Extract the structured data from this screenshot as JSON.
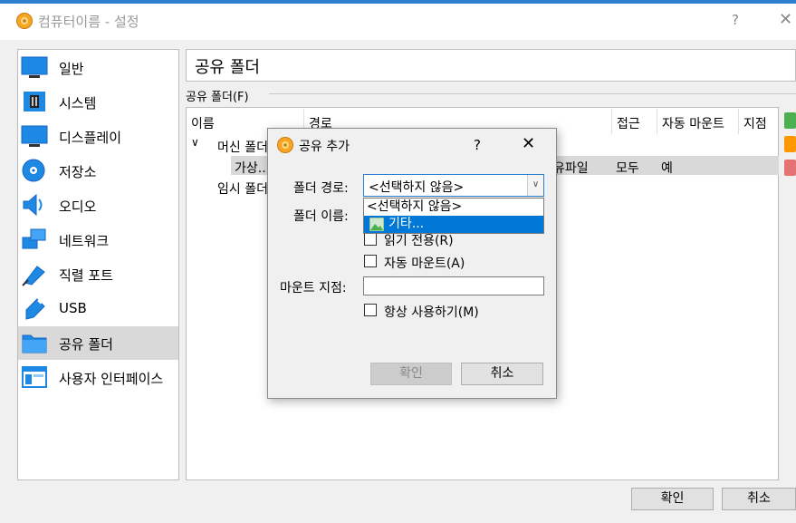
{
  "window": {
    "title": "컴퓨터이름 - 설정",
    "help_label": "?",
    "close_label": "✕"
  },
  "sidebar": {
    "items": [
      {
        "label": "일반",
        "icon": "monitor-icon"
      },
      {
        "label": "시스템",
        "icon": "chip-icon"
      },
      {
        "label": "디스플레이",
        "icon": "display-icon"
      },
      {
        "label": "저장소",
        "icon": "disk-icon"
      },
      {
        "label": "오디오",
        "icon": "speaker-icon"
      },
      {
        "label": "네트워크",
        "icon": "network-icon"
      },
      {
        "label": "직렬 포트",
        "icon": "serial-port-icon"
      },
      {
        "label": "USB",
        "icon": "usb-icon"
      },
      {
        "label": "공유 폴더",
        "icon": "folder-icon",
        "selected": true
      },
      {
        "label": "사용자 인터페이스",
        "icon": "ui-window-icon"
      }
    ]
  },
  "main": {
    "page_title": "공유 폴더",
    "group_label": "공유 폴더(F)",
    "table": {
      "headers": [
        "이름",
        "경로",
        "접근",
        "자동 마운트",
        "지점"
      ],
      "rows": [
        {
          "name": "머신 폴더"
        },
        {
          "name": "가상...",
          "path_tail": "유파일",
          "access": "모두",
          "automount": "예"
        },
        {
          "name": "임시 폴더"
        }
      ]
    }
  },
  "footer": {
    "ok_label": "확인",
    "cancel_label": "취소"
  },
  "dialog": {
    "title": "공유 추가",
    "help_label": "?",
    "close_label": "✕",
    "folder_path_label": "폴더 경로:",
    "folder_path_value": "<선택하지 않음>",
    "folder_name_label": "폴더 이름:",
    "dropdown_items": [
      "<선택하지 않음>",
      "기타..."
    ],
    "read_only_label": "읽기 전용(R)",
    "auto_mount_label": "자동 마운트(A)",
    "mount_point_label": "마운트 지점:",
    "mount_point_value": "",
    "permanent_label": "항상 사용하기(M)",
    "ok_label": "확인",
    "cancel_label": "취소"
  },
  "colors": {
    "accent": "#0078d7",
    "title_border": "#2d7ed0",
    "selected_bg": "#d9d9d9"
  }
}
